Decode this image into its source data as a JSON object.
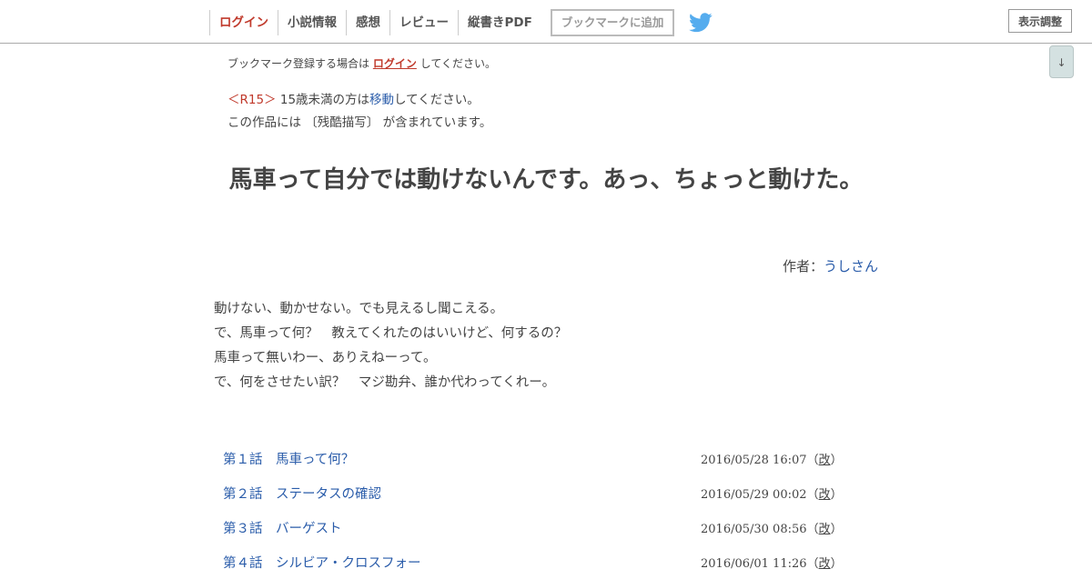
{
  "nav": {
    "login": "ログイン",
    "novel_info": "小説情報",
    "impressions": "感想",
    "review": "レビュー",
    "vertical_pdf": "縦書きPDF",
    "bookmark_add": "ブックマークに追加",
    "display_settings": "表示調整",
    "scroll_down": "↓"
  },
  "bookmark_note": {
    "before": "ブックマーク登録する場合は",
    "link": "ログイン",
    "after": "してください。"
  },
  "age_notice": {
    "tag": "＜R15＞",
    "before": "15歳未満の方は",
    "link": "移動",
    "after": "してください。"
  },
  "content_warning": "この作品には 〔残酷描写〕 が含まれています。",
  "title": "馬車って自分では動けないんです。あっ、ちょっと動けた。",
  "author": {
    "label": "作者：",
    "name": "うしさん"
  },
  "synopsis": [
    "動けない、動かせない。でも見えるし聞こえる。",
    "で、馬車って何？　教えてくれたのはいいけど、何するの？",
    "馬車って無いわー、ありえねーって。",
    "で、何をさせたい訳？　マジ勘弁、誰か代わってくれー。"
  ],
  "chapters": [
    {
      "title": "第１話　馬車って何？",
      "date": "2016/05/28 16:07",
      "open": "（",
      "revised": "改",
      "close": "）"
    },
    {
      "title": "第２話　ステータスの確認",
      "date": "2016/05/29 00:02",
      "open": "（",
      "revised": "改",
      "close": "）"
    },
    {
      "title": "第３話　バーゲスト",
      "date": "2016/05/30 08:56",
      "open": "（",
      "revised": "改",
      "close": "）"
    },
    {
      "title": "第４話　シルビア・クロスフォー",
      "date": "2016/06/01 11:26",
      "open": "（",
      "revised": "改",
      "close": "）"
    }
  ],
  "colors": {
    "accent_red": "#c0392b",
    "link_blue": "#2a5caa",
    "twitter_blue": "#55acee"
  },
  "icons": {
    "twitter": "twitter-bird-icon"
  }
}
